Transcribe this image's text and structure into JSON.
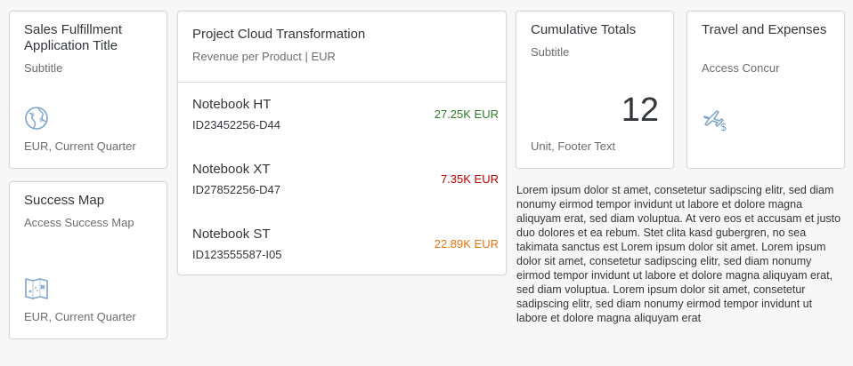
{
  "colors": {
    "positive": "#2b7c2b",
    "negative": "#bb0000",
    "critical": "#e9730c",
    "icon": "#7da3c8"
  },
  "tile_sales": {
    "title": "Sales Fulfillment Application Title",
    "subtitle": "Subtitle",
    "icon": "globe-icon",
    "footer": "EUR, Current Quarter"
  },
  "tile_success": {
    "title": "Success Map",
    "subtitle": "Access Success Map",
    "icon": "map-icon",
    "footer": "EUR, Current Quarter"
  },
  "project_card": {
    "title": "Project Cloud Transformation",
    "subtitle": "Revenue per Product | EUR",
    "items": [
      {
        "title": "Notebook HT",
        "id": "ID23452256-D44",
        "value": "27.25K EUR",
        "state": "positive"
      },
      {
        "title": "Notebook XT",
        "id": "ID27852256-D47",
        "value": "7.35K EUR",
        "state": "negative"
      },
      {
        "title": "Notebook ST",
        "id": "ID123555587-I05",
        "value": "22.89K EUR",
        "state": "critical"
      }
    ]
  },
  "tile_cumulative": {
    "title": "Cumulative Totals",
    "subtitle": "Subtitle",
    "value": "12",
    "footer": "Unit, Footer Text"
  },
  "tile_travel": {
    "title": "Travel and Expenses",
    "subtitle": "Access Concur",
    "icon": "travel-expense-icon"
  },
  "lorem_text": "Lorem ipsum dolor st amet, consetetur sadipscing elitr, sed diam nonumy eirmod tempor invidunt ut labore et dolore magna aliquyam erat, sed diam voluptua. At vero eos et accusam et justo duo dolores et ea rebum. Stet clita kasd gubergren, no sea takimata sanctus est Lorem ipsum dolor sit amet. Lorem ipsum dolor sit amet, consetetur sadipscing elitr, sed diam nonumy eirmod tempor invidunt ut labore et dolore magna aliquyam erat, sed diam voluptua. Lorem ipsum dolor sit amet, consetetur sadipscing elitr, sed diam nonumy eirmod tempor invidunt ut labore et dolore magna aliquyam erat"
}
